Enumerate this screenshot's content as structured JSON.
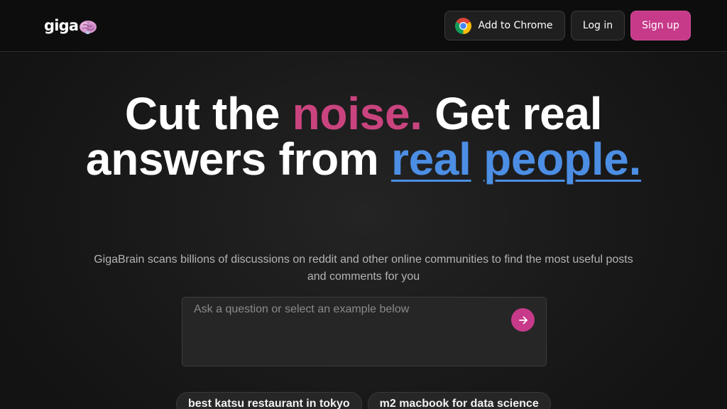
{
  "header": {
    "logo_text": "giga",
    "logo_icon": "brain-icon",
    "add_to_chrome_label": "Add to Chrome",
    "chrome_icon": "chrome-icon",
    "login_label": "Log in",
    "signup_label": "Sign up"
  },
  "hero": {
    "part1": "Cut the ",
    "highlight1": "noise.",
    "part2": " Get real answers from ",
    "highlight2a": "real",
    "highlight2b": "people."
  },
  "subtitle": "GigaBrain scans billions of discussions on reddit and other online communities to find the most useful posts and comments for you",
  "search": {
    "placeholder": "Ask a question or select an example below",
    "submit_icon": "arrow-right-icon"
  },
  "examples": [
    "best katsu restaurant in tokyo",
    "m2 macbook for data science"
  ],
  "colors": {
    "accent_pink": "#c73a8a",
    "highlight_pink": "#c9447f",
    "highlight_blue": "#4c8ee4",
    "background": "#161616"
  }
}
